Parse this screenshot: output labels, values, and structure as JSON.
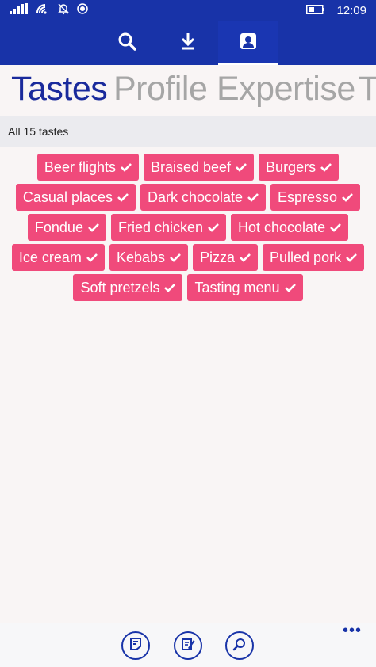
{
  "status_bar": {
    "time": "12:09",
    "icons": [
      "signal-icon",
      "wifi-icon",
      "quiet-hours-icon",
      "location-icon",
      "battery-icon"
    ]
  },
  "top_nav": {
    "buttons": [
      {
        "icon": "search-icon",
        "active": false
      },
      {
        "icon": "download-icon",
        "active": false
      },
      {
        "icon": "profile-icon",
        "active": true
      }
    ]
  },
  "pivot": {
    "items": [
      "Tastes",
      "Profile",
      "Expertise",
      "T"
    ],
    "selected": "Tastes"
  },
  "filter": {
    "label": "All 15 tastes"
  },
  "tags": {
    "rows": [
      [
        "Beer flights",
        "Braised beef",
        "Burgers"
      ],
      [
        "Casual places",
        "Dark chocolate",
        "Espresso"
      ],
      [
        "Fondue",
        "Fried chicken",
        "Hot chocolate"
      ],
      [
        "Ice cream",
        "Kebabs",
        "Pizza",
        "Pulled pork"
      ],
      [
        "Soft pretzels",
        "Tasting menu"
      ]
    ],
    "tag_color": "#f04a7b"
  },
  "app_bar": {
    "buttons": [
      "feedback-icon",
      "edit-icon",
      "search-icon"
    ],
    "more": "•••"
  },
  "colors": {
    "accent": "#1833a8",
    "pivot_selected": "#1a2a9c",
    "pivot_dim": "#a6a6a6",
    "background": "#f9f5f5"
  }
}
